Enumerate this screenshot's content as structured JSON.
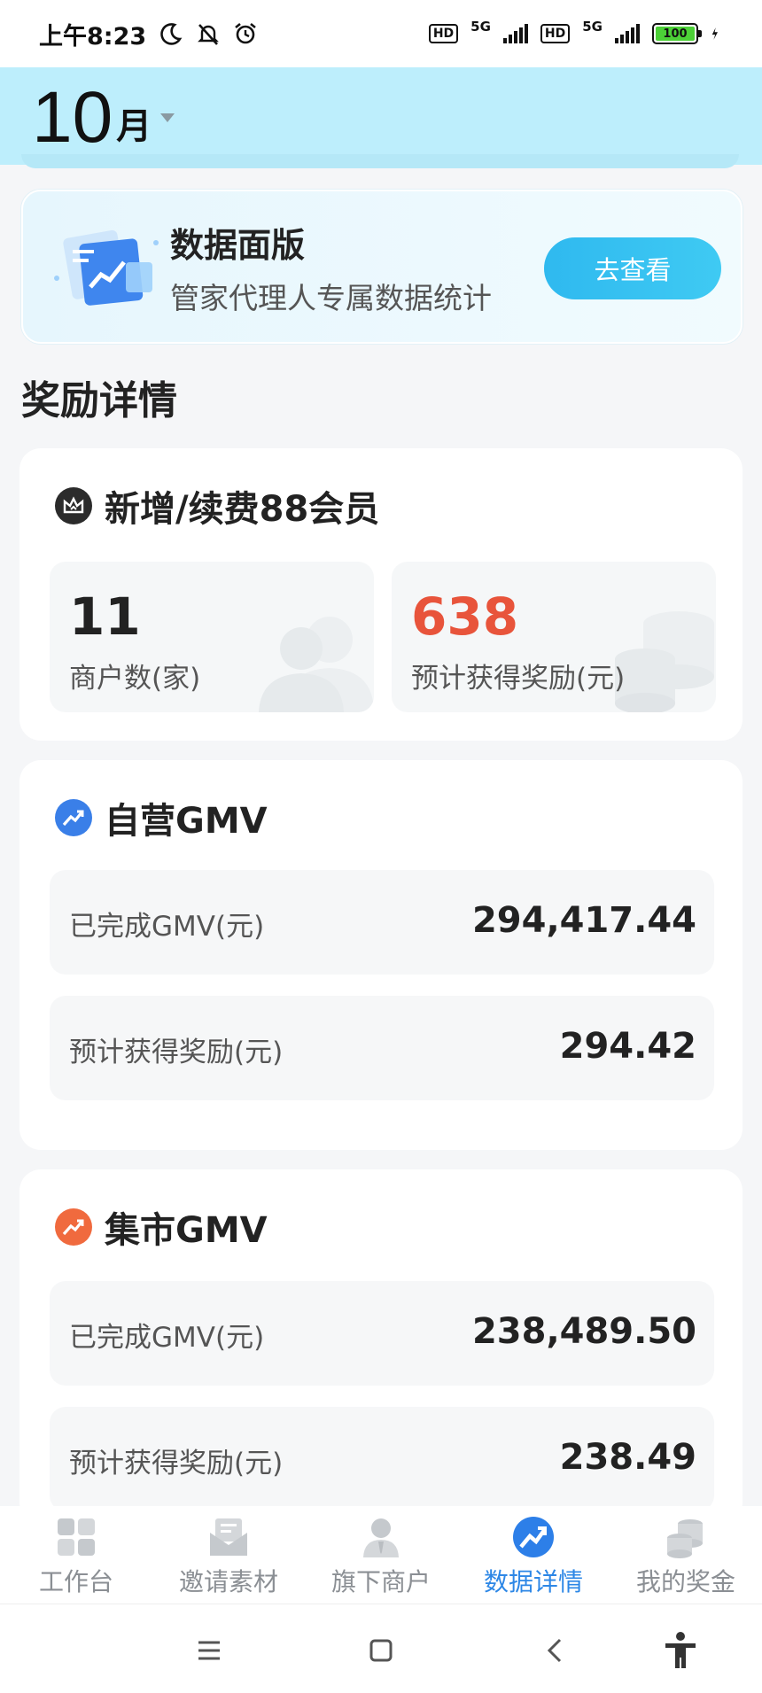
{
  "status_bar": {
    "time": "上午8:23",
    "hd_label": "HD",
    "network_label": "5G",
    "battery_level": "100",
    "icons": [
      "moon-icon",
      "mute-icon",
      "alarm-icon",
      "signal-icon",
      "battery-icon",
      "charging-icon"
    ]
  },
  "header": {
    "month_number": "10",
    "month_unit": "月"
  },
  "data_panel": {
    "title": "数据面版",
    "subtitle": "管家代理人专属数据统计",
    "button_label": "去查看"
  },
  "section_title": "奖励详情",
  "member_card": {
    "title": "新增/续费88会员",
    "merchant_count": "11",
    "merchant_label": "商户数(家)",
    "reward_value": "638",
    "reward_label": "预计获得奖励(元)"
  },
  "self_gmv_card": {
    "title": "自营GMV",
    "completed_label": "已完成GMV(元)",
    "completed_value": "294,417.44",
    "reward_label": "预计获得奖励(元)",
    "reward_value": "294.42"
  },
  "market_gmv_card": {
    "title": "集市GMV",
    "completed_label": "已完成GMV(元)",
    "completed_value": "238,489.50",
    "reward_label": "预计获得奖励(元)",
    "reward_value": "238.49"
  },
  "bottom_nav": {
    "items": [
      {
        "label": "工作台",
        "icon": "dashboard-grid-icon"
      },
      {
        "label": "邀请素材",
        "icon": "invite-envelope-icon"
      },
      {
        "label": "旗下商户",
        "icon": "merchant-person-icon"
      },
      {
        "label": "数据详情",
        "icon": "trend-chart-icon"
      },
      {
        "label": "我的奖金",
        "icon": "coins-icon"
      }
    ],
    "active_index": 3
  },
  "colors": {
    "header_bg": "#bdeefc",
    "accent_blue": "#2d87e6",
    "reward_red": "#e8543b",
    "button_blue": "#2fb9ef"
  }
}
